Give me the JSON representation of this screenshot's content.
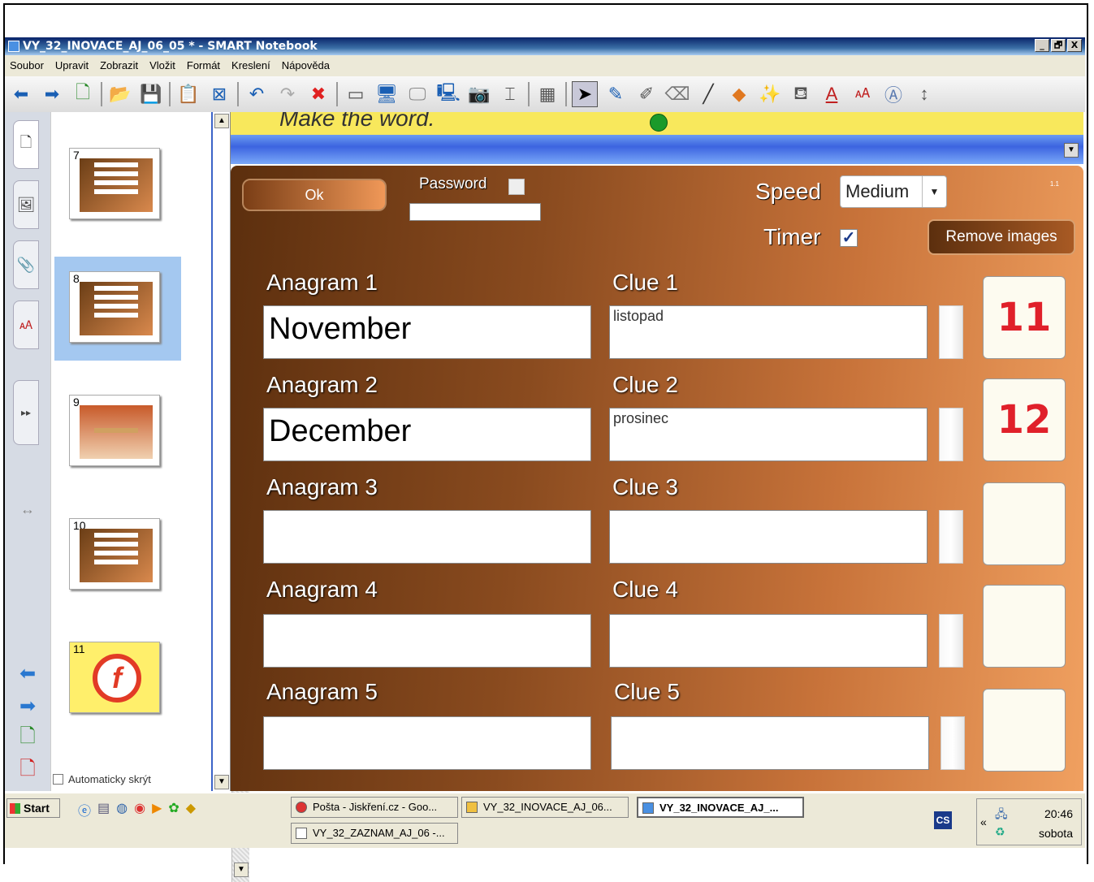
{
  "window": {
    "title": "VY_32_INOVACE_AJ_06_05 * - SMART Notebook",
    "controls": [
      "_",
      "🗗",
      "X"
    ]
  },
  "menu": [
    "Soubor",
    "Upravit",
    "Zobrazit",
    "Vložit",
    "Formát",
    "Kreslení",
    "Nápověda"
  ],
  "toolbar": {
    "icons": [
      "back-arrow",
      "forward-arrow",
      "add-page",
      "open-folder",
      "save",
      "paste",
      "delete-page",
      "undo",
      "redo",
      "delete",
      "screen-shade",
      "full-screen",
      "dual-display",
      "capture",
      "document-camera",
      "table",
      "select",
      "pen",
      "creative-pen",
      "eraser",
      "line",
      "shapes",
      "magic-pen",
      "fill",
      "text",
      "properties",
      "move"
    ]
  },
  "sidebar": {
    "tabs": [
      "page-sorter",
      "gallery",
      "attachments",
      "properties"
    ],
    "autohide_label": "Automaticky skrýt"
  },
  "sorter": {
    "thumbnails": [
      {
        "num": "7",
        "kind": "brown"
      },
      {
        "num": "8",
        "kind": "brown"
      },
      {
        "num": "9",
        "kind": "beads"
      },
      {
        "num": "10",
        "kind": "brown"
      },
      {
        "num": "11",
        "kind": "yellow",
        "logo": "f"
      }
    ]
  },
  "page": {
    "title": "Make the word."
  },
  "panel": {
    "ok_label": "Ok",
    "password_label": "Password",
    "speed_label": "Speed",
    "speed_value": "Medium",
    "timer_label": "Timer",
    "timer_checked": "✓",
    "remove_images_label": "Remove images",
    "corner_label": "1.1",
    "rows": [
      {
        "anagram_label": "Anagram 1",
        "clue_label": "Clue 1",
        "anagram": "November",
        "clue": "listopad",
        "image": "11",
        "image_color": "#e0202a"
      },
      {
        "anagram_label": "Anagram 2",
        "clue_label": "Clue 2",
        "anagram": "December",
        "clue": "prosinec",
        "image": "12",
        "image_color": "#e0202a"
      },
      {
        "anagram_label": "Anagram 3",
        "clue_label": "Clue 3",
        "anagram": "",
        "clue": "",
        "image": ""
      },
      {
        "anagram_label": "Anagram 4",
        "clue_label": "Clue 4",
        "anagram": "",
        "clue": "",
        "image": ""
      },
      {
        "anagram_label": "Anagram 5",
        "clue_label": "Clue 5",
        "anagram": "",
        "clue": "",
        "image": ""
      }
    ]
  },
  "taskbar": {
    "start_label": "Start",
    "buttons": [
      {
        "label": "Pošta - Jiskření.cz - Goo..."
      },
      {
        "label": "VY_32_INOVACE_AJ_06..."
      },
      {
        "label": "VY_32_INOVACE_AJ_..."
      },
      {
        "label": "VY_32_ZAZNAM_AJ_06 -..."
      }
    ],
    "lang": "CS",
    "time": "20:46",
    "day": "sobota"
  }
}
